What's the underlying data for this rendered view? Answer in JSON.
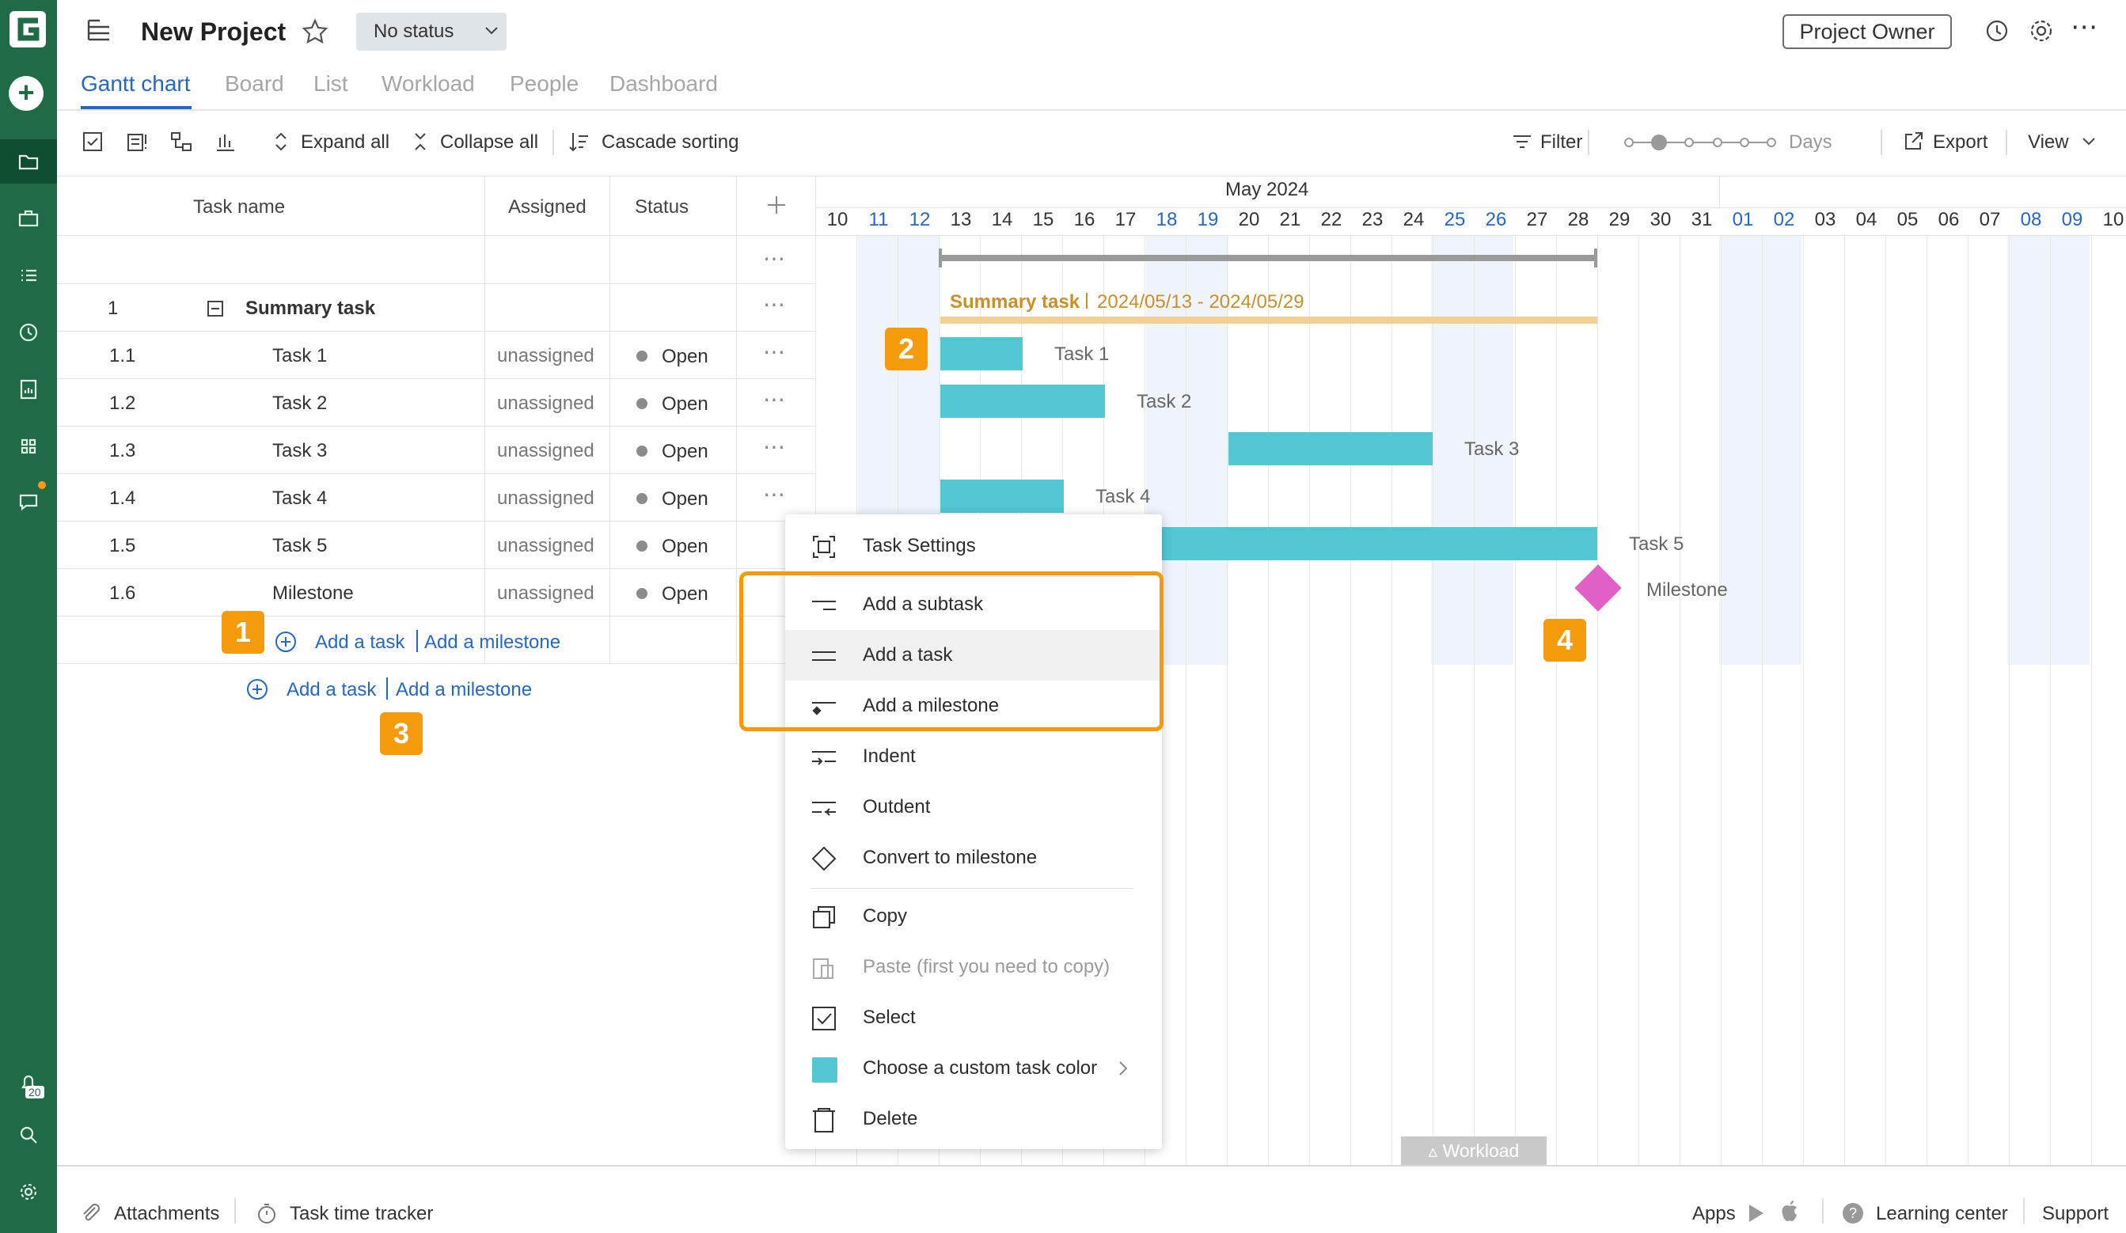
{
  "header": {
    "project_title": "New Project",
    "status": "No status",
    "role_button": "Project Owner"
  },
  "tabs": [
    "Gantt chart",
    "Board",
    "List",
    "Workload",
    "People",
    "Dashboard"
  ],
  "toolbar": {
    "expand_all": "Expand all",
    "collapse_all": "Collapse all",
    "cascade_sorting": "Cascade sorting",
    "filter": "Filter",
    "zoom_unit": "Days",
    "export": "Export",
    "view": "View"
  },
  "grid": {
    "columns": [
      "Task name",
      "Assigned",
      "Status"
    ],
    "summary": {
      "num": "1",
      "name": "Summary task"
    },
    "rows": [
      {
        "num": "1.1",
        "name": "Task 1",
        "assigned": "unassigned",
        "status": "Open"
      },
      {
        "num": "1.2",
        "name": "Task 2",
        "assigned": "unassigned",
        "status": "Open"
      },
      {
        "num": "1.3",
        "name": "Task 3",
        "assigned": "unassigned",
        "status": "Open"
      },
      {
        "num": "1.4",
        "name": "Task 4",
        "assigned": "unassigned",
        "status": "Open"
      },
      {
        "num": "1.5",
        "name": "Task 5",
        "assigned": "unassigned",
        "status": "Open"
      },
      {
        "num": "1.6",
        "name": "Milestone",
        "assigned": "unassigned",
        "status": "Open"
      }
    ],
    "add_task": "Add a task",
    "add_milestone": "Add a milestone"
  },
  "gantt": {
    "month": "May 2024",
    "days": [
      "10",
      "11",
      "12",
      "13",
      "14",
      "15",
      "16",
      "17",
      "18",
      "19",
      "20",
      "21",
      "22",
      "23",
      "24",
      "25",
      "26",
      "27",
      "28",
      "29",
      "30",
      "31",
      "01",
      "02",
      "03",
      "04",
      "05",
      "06",
      "07",
      "08",
      "09",
      "10"
    ],
    "summary_label": "Summary task",
    "summary_dates": "2024/05/13 - 2024/05/29",
    "bars": [
      "Task 1",
      "Task 2",
      "Task 3",
      "Task 4",
      "Task 5"
    ],
    "milestone": "Milestone",
    "workload_tab": "Workload"
  },
  "badges": [
    "1",
    "2",
    "3",
    "4"
  ],
  "context_menu": {
    "items": [
      "Task Settings",
      "Add a subtask",
      "Add a task",
      "Add a milestone",
      "Indent",
      "Outdent",
      "Convert to milestone",
      "Copy",
      "Paste (first you need to copy)",
      "Select",
      "Choose a custom task color",
      "Delete"
    ]
  },
  "footer": {
    "attachments": "Attachments",
    "time_tracker": "Task time tracker",
    "apps": "Apps",
    "learning_center": "Learning center",
    "support": "Support"
  },
  "sidebar": {
    "notification_count": "20"
  },
  "colors": {
    "sidebar": "#1f6b45",
    "accent": "#2567c5",
    "task_bar": "#53c7d4",
    "milestone": "#e060c8",
    "highlight": "#f59b0b"
  }
}
